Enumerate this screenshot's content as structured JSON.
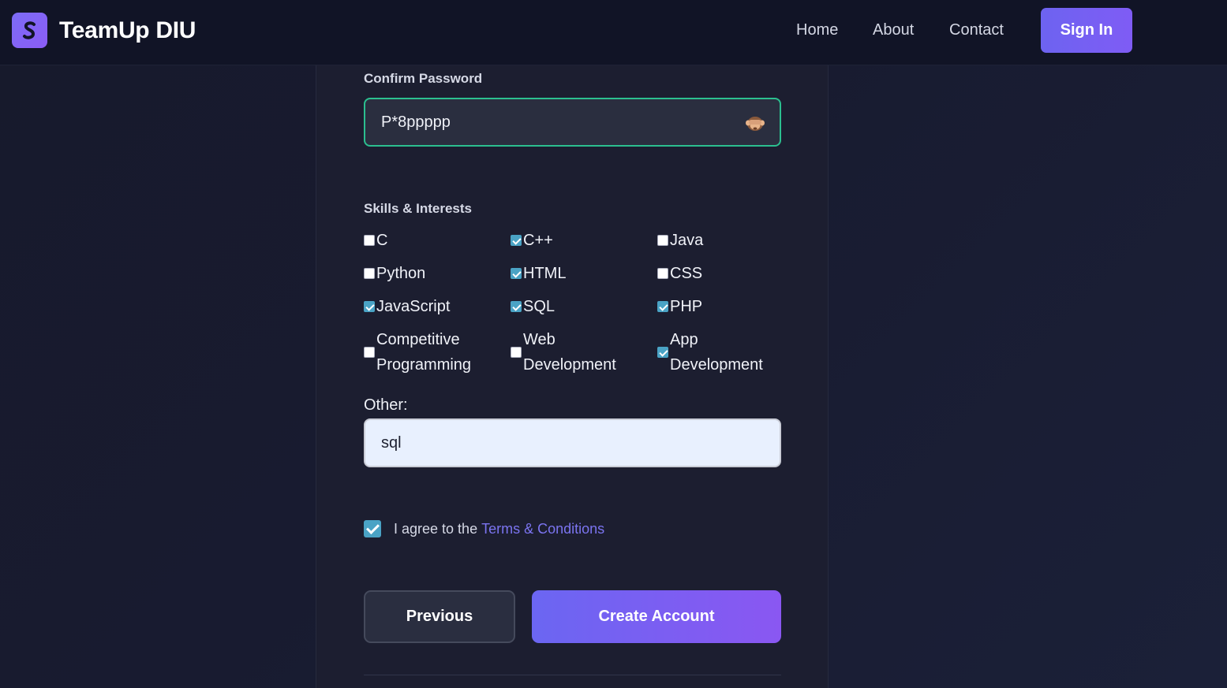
{
  "nav": {
    "brand": "TeamUp DIU",
    "links": [
      "Home",
      "About",
      "Contact"
    ],
    "signin": "Sign In"
  },
  "form": {
    "confirm_password": {
      "label": "Confirm Password",
      "value": "P*8ppppp"
    },
    "skills": {
      "label": "Skills & Interests",
      "items": [
        {
          "label": "C",
          "checked": false
        },
        {
          "label": "C++",
          "checked": true
        },
        {
          "label": "Java",
          "checked": false
        },
        {
          "label": "Python",
          "checked": false
        },
        {
          "label": "HTML",
          "checked": true
        },
        {
          "label": "CSS",
          "checked": false
        },
        {
          "label": "JavaScript",
          "checked": true
        },
        {
          "label": "SQL",
          "checked": true
        },
        {
          "label": "PHP",
          "checked": true
        },
        {
          "label": "Competitive Programming",
          "checked": false
        },
        {
          "label": "Web Development",
          "checked": false
        },
        {
          "label": "App Development",
          "checked": true
        }
      ]
    },
    "other": {
      "label": "Other:",
      "value": "sql"
    },
    "agree": {
      "text": "I agree to the",
      "link": "Terms & Conditions",
      "checked": true
    },
    "buttons": {
      "previous": "Previous",
      "create": "Create Account"
    }
  },
  "colors": {
    "accent": "#6d63f0",
    "focus_border": "#2bbf8f",
    "checkbox": "#4aa3c5"
  }
}
